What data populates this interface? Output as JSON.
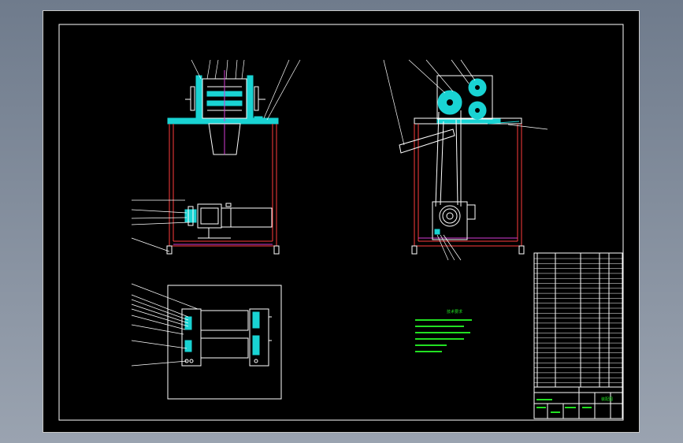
{
  "drawing": {
    "tech_notes_title": "技术要求",
    "title_block_name": "装配图",
    "colors": {
      "sheet": "#000000",
      "outline": "#ffffff",
      "frame": "#ff3b3b",
      "part": "#19d3d3",
      "notes": "#22e022",
      "centerline": "#d43cd4"
    }
  }
}
